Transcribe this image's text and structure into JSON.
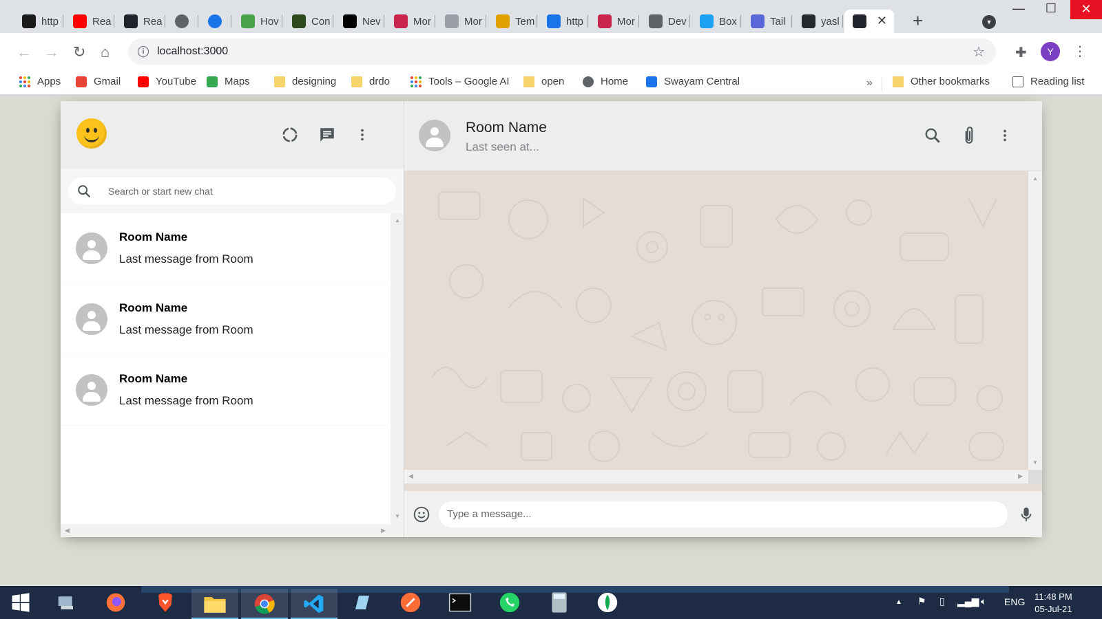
{
  "browser": {
    "tabs": [
      {
        "label": "http",
        "icon": "devto-icon",
        "color": "#1a1a1a"
      },
      {
        "label": "Rea",
        "icon": "youtube-icon",
        "color": "#ff0000"
      },
      {
        "label": "Rea",
        "icon": "react-icon",
        "color": "#20232a"
      },
      {
        "label": "",
        "icon": "circle-icon",
        "color": "#5f6368"
      },
      {
        "label": "",
        "icon": "circle-icon",
        "color": "#1a73e8"
      },
      {
        "label": "Hov",
        "icon": "leaf-icon",
        "color": "#47a248"
      },
      {
        "label": "Con",
        "icon": "leaf-icon",
        "color": "#2c4a1b"
      },
      {
        "label": "Nev",
        "icon": "medium-icon",
        "color": "#000000"
      },
      {
        "label": "Mor",
        "icon": "m-icon",
        "color": "#c7254e"
      },
      {
        "label": "Mor",
        "icon": "dash-icon",
        "color": "#9aa0a6"
      },
      {
        "label": "Tem",
        "icon": "pencil-icon",
        "color": "#e0a100"
      },
      {
        "label": "http",
        "icon": "diamond-icon",
        "color": "#1a73e8"
      },
      {
        "label": "Mor",
        "icon": "m-icon",
        "color": "#c7254e"
      },
      {
        "label": "Dev",
        "icon": "globe-icon",
        "color": "#5f6368"
      },
      {
        "label": "Box",
        "icon": "wave-icon",
        "color": "#1da1f2"
      },
      {
        "label": "Tail",
        "icon": "box-icon",
        "color": "#5a67d8"
      },
      {
        "label": "yasl",
        "icon": "github-icon",
        "color": "#24292e"
      },
      {
        "label": "",
        "icon": "react-icon",
        "color": "#20232a",
        "active": true
      }
    ],
    "url": "localhost:3000",
    "profile_initial": "Y",
    "bookmarks": [
      {
        "label": "Apps",
        "icon": "apps-icon"
      },
      {
        "label": "Gmail",
        "icon": "gmail-icon",
        "color": "#ea4335"
      },
      {
        "label": "YouTube",
        "icon": "youtube-icon",
        "color": "#ff0000"
      },
      {
        "label": "Maps",
        "icon": "maps-icon",
        "color": "#34a853"
      },
      {
        "label": "designing",
        "icon": "folder-icon"
      },
      {
        "label": "drdo",
        "icon": "folder-icon"
      },
      {
        "label": "Tools – Google AI",
        "icon": "dots-icon"
      },
      {
        "label": "open",
        "icon": "folder-icon"
      },
      {
        "label": "Home",
        "icon": "globe-icon",
        "color": "#5f6368"
      },
      {
        "label": "Swayam Central",
        "icon": "swayam-icon",
        "color": "#1a73e8"
      }
    ],
    "other_bookmarks": "Other bookmarks",
    "reading_list": "Reading list"
  },
  "app": {
    "search": {
      "placeholder": "Search or start new chat"
    },
    "rooms": [
      {
        "name": "Room Name",
        "last_message": "Last message from Room"
      },
      {
        "name": "Room Name",
        "last_message": "Last message from Room"
      },
      {
        "name": "Room Name",
        "last_message": "Last message from Room"
      }
    ],
    "chat": {
      "title": "Room Name",
      "subtitle": "Last seen at...",
      "message_placeholder": "Type a message..."
    },
    "colors": {
      "chat_background": "#e5ddd5",
      "header": "#ededed",
      "page": "#dadbd3"
    }
  },
  "taskbar": {
    "time": "11:48 PM",
    "date": "05-Jul-21",
    "language": "ENG",
    "apps": [
      "windows-start-icon",
      "network-drive-icon",
      "firefox-icon",
      "brave-icon",
      "file-explorer-icon",
      "chrome-icon",
      "vscode-icon",
      "notepad-icon",
      "postman-icon",
      "terminal-icon",
      "whatsapp-icon",
      "calculator-icon",
      "mongodb-compass-icon"
    ]
  }
}
